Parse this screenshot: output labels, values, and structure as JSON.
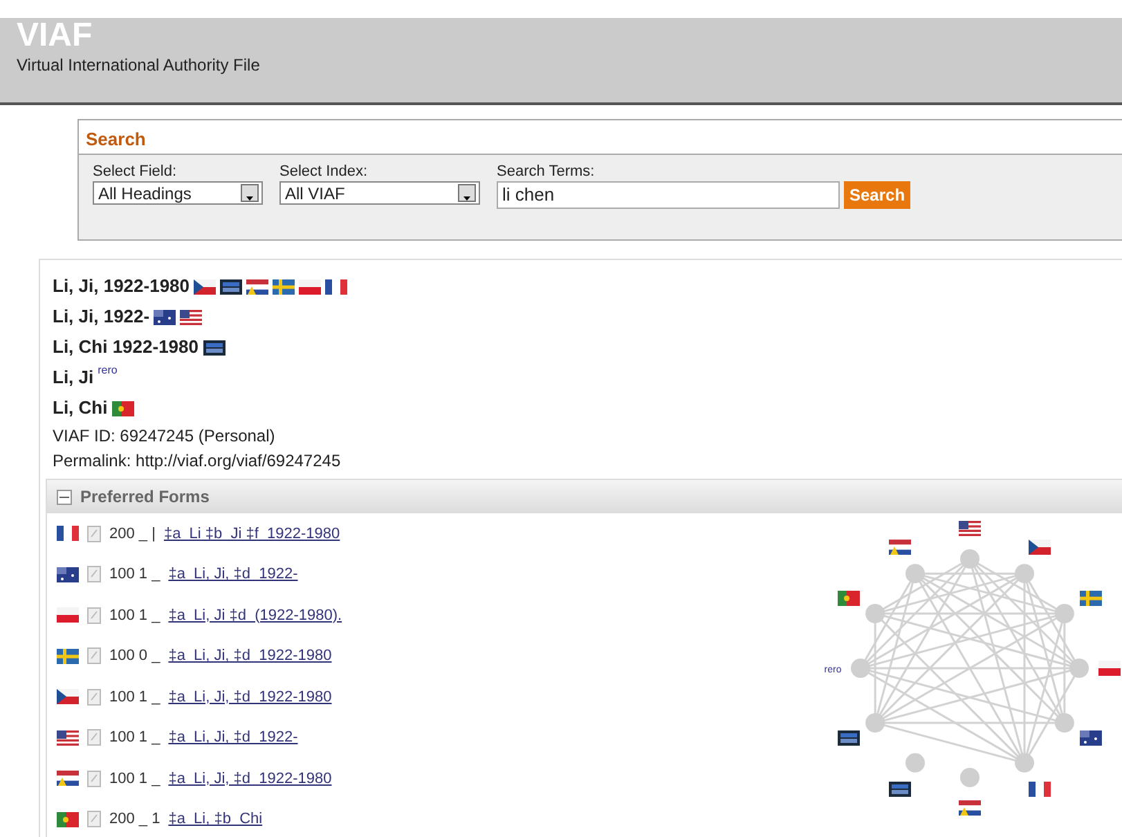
{
  "header": {
    "logo": "VIAF",
    "subtitle": "Virtual International Authority File"
  },
  "search": {
    "title": "Search",
    "fields": [
      {
        "label": "Select Field:",
        "kind": "select",
        "value": "All Headings"
      },
      {
        "label": "Select Index:",
        "kind": "select",
        "value": "All VIAF"
      },
      {
        "label": "Search Terms:",
        "kind": "text",
        "value": "li chen"
      }
    ],
    "button": "Search"
  },
  "headings": [
    {
      "text": "Li, Ji, 1922-1980",
      "sources": [
        {
          "kind": "cz"
        },
        {
          "kind": "dnb"
        },
        {
          "kind": "nl"
        },
        {
          "kind": "se"
        },
        {
          "kind": "pl"
        },
        {
          "kind": "fr"
        }
      ]
    },
    {
      "text": "Li, Ji, 1922-",
      "sources": [
        {
          "kind": "au"
        },
        {
          "kind": "us"
        }
      ]
    },
    {
      "text": "Li, Chi 1922-1980",
      "sources": [
        {
          "kind": "dnb"
        }
      ]
    },
    {
      "text": "Li, Ji",
      "sources": [
        {
          "kind": "rero",
          "label": "rero"
        }
      ]
    },
    {
      "text": "Li, Chi",
      "sources": [
        {
          "kind": "pt"
        }
      ]
    }
  ],
  "viaf_id": "VIAF ID: 69247245 (Personal)",
  "permalink": "Permalink: http://viaf.org/viaf/69247245",
  "preferred_forms": {
    "title": "Preferred Forms",
    "expanded": true,
    "rows": [
      {
        "kind": "fr",
        "tag": "200 _ |",
        "link": "‡a  Li ‡b  Ji ‡f  1922-1980"
      },
      {
        "kind": "au",
        "tag": "100 1 _",
        "link": "‡a  Li, Ji, ‡d  1922-"
      },
      {
        "kind": "pl",
        "tag": "100 1 _",
        "link": "‡a  Li, Ji ‡d  (1922-1980)."
      },
      {
        "kind": "se",
        "tag": "100 0 _",
        "link": "‡a  Li, Ji, ‡d  1922-1980"
      },
      {
        "kind": "cz",
        "tag": "100 1 _",
        "link": "‡a  Li, Ji, ‡d  1922-1980"
      },
      {
        "kind": "us",
        "tag": "100 1 _",
        "link": "‡a  Li, Ji, ‡d  1922-"
      },
      {
        "kind": "nl",
        "tag": "100 1 _",
        "link": "‡a  Li, Ji, ‡d  1922-1980"
      },
      {
        "kind": "pt",
        "tag": "200 _ 1",
        "link": "‡a  Li, ‡b  Chi"
      }
    ],
    "graph_nodes": [
      {
        "kind": "us"
      },
      {
        "kind": "cz"
      },
      {
        "kind": "se"
      },
      {
        "kind": "pl"
      },
      {
        "kind": "au"
      },
      {
        "kind": "fr"
      },
      {
        "kind": "nl"
      },
      {
        "kind": "dnb"
      },
      {
        "kind": "dnb"
      },
      {
        "kind": "rero",
        "label": "rero"
      },
      {
        "kind": "pt"
      },
      {
        "kind": "nl"
      }
    ]
  }
}
